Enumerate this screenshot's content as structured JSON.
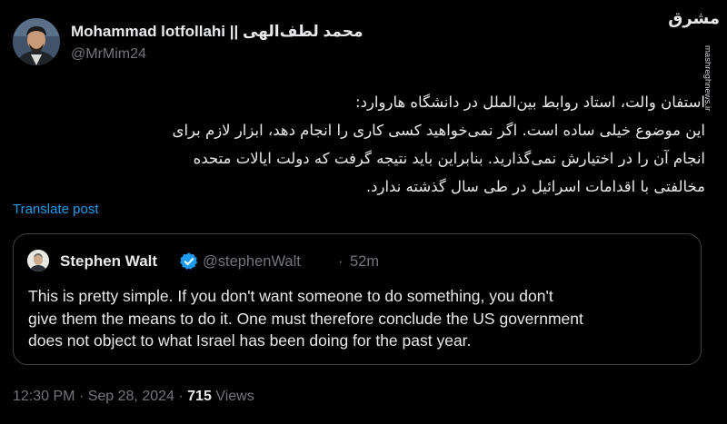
{
  "author": {
    "name": "Mohammad lotfollahi || محمد لطف‌الهی",
    "handle": "@MrMim24"
  },
  "watermark": {
    "logo": "مشرق",
    "site": "mashreghnews.ir"
  },
  "post": {
    "lines": [
      "استفان والت، استاد روابط بین‌الملل در دانشگاه هاروارد:",
      "این موضوع خیلی ساده است. اگر نمی‌خواهید کسی کاری را انجام دهد، ابزار لازم برای",
      "انجام آن را در اختیارش نمی‌گذارید. بنابراین باید نتیجه گرفت که دولت ایالات متحده",
      "مخالفتی با اقدامات اسرائیل در طی سال گذشته ندارد."
    ],
    "translate_label": "Translate post",
    "time": "12:30 PM",
    "date": "Sep 28, 2024",
    "views_count": "715",
    "views_label": "Views"
  },
  "quote": {
    "name": "Stephen Walt",
    "handle": "@stephenWalt",
    "time": "52m",
    "lines": [
      "This is pretty simple.  If you don't want someone to do something, you don't",
      "give them the means to do it. One must therefore conclude the US government",
      "does not object to what Israel has been doing for the past year."
    ]
  },
  "colors": {
    "background": "#000000",
    "text": "#e7e9ea",
    "muted": "#71767b",
    "accent": "#1d9bf0",
    "border": "#3a3f44"
  },
  "icons": [
    "verified-badge-icon"
  ]
}
